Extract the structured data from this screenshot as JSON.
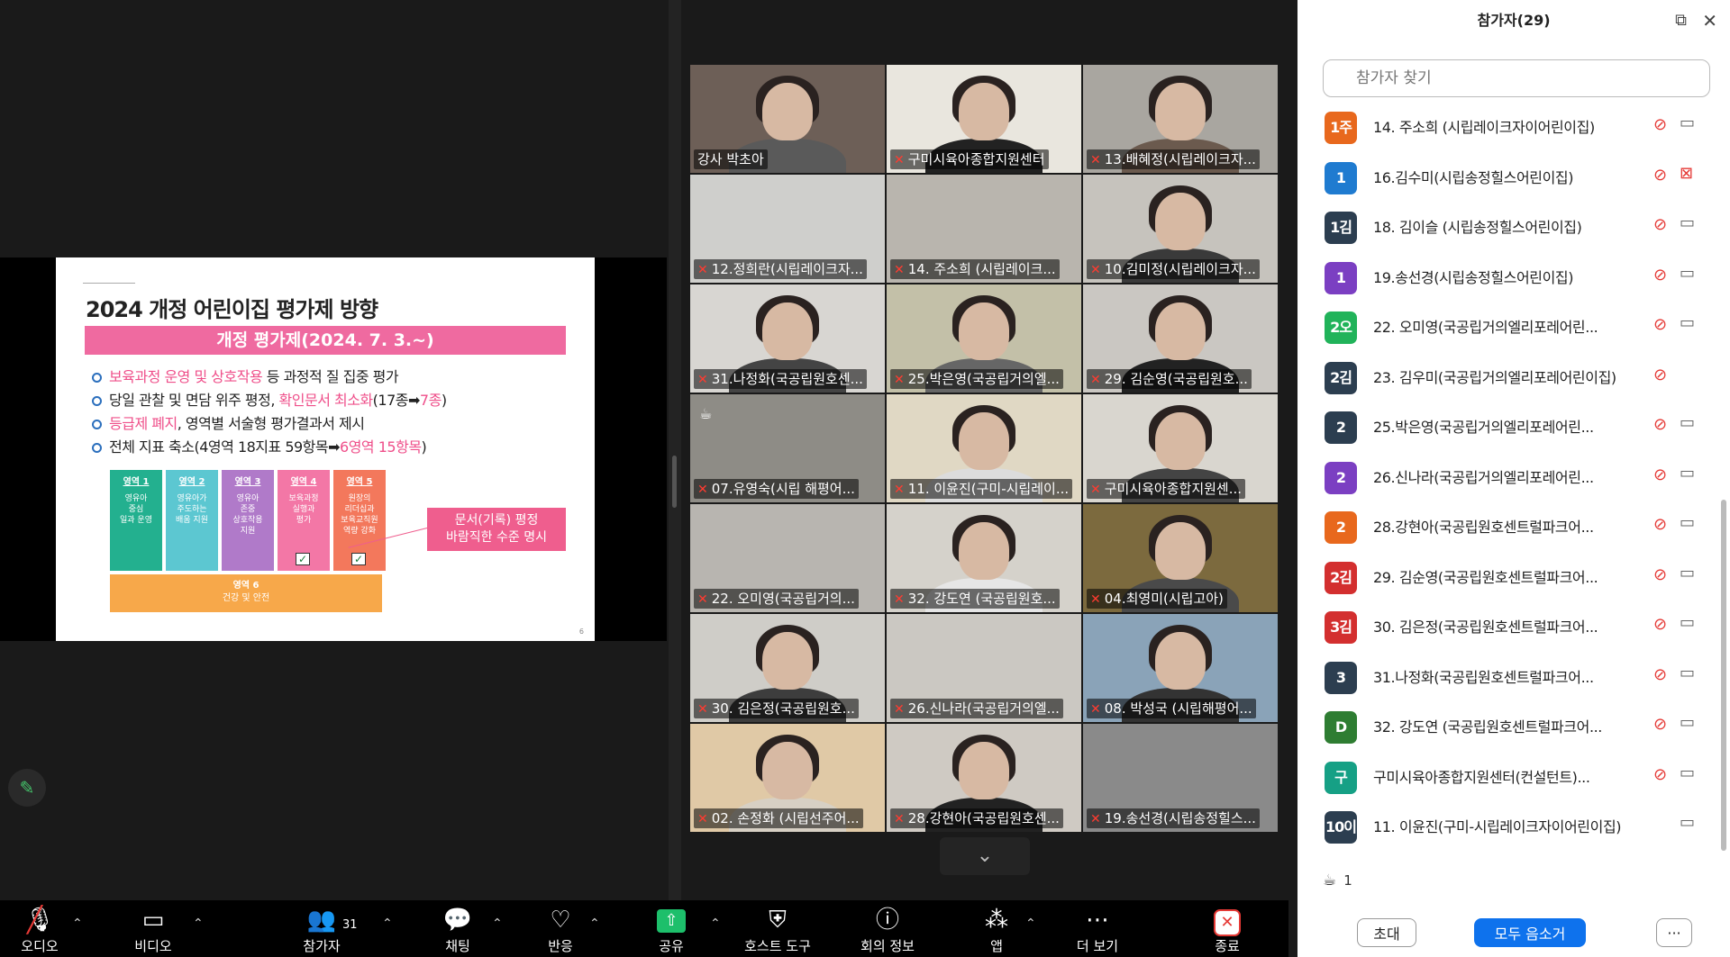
{
  "slide": {
    "title": "2024 개정 어린이집 평가제 방향",
    "band": "개정 평가제(2024. 7. 3.~)",
    "bullets": [
      {
        "hl": "보육과정 운영 및 상호작용",
        "text": " 등 과정적 질 집중 평가"
      },
      {
        "pre": "당일 관찰 및 면담 위주 평정, ",
        "hl": "확인문서 최소화",
        "mid": "(17종➡",
        "hl2": "7종",
        "post": ")"
      },
      {
        "hl": "등급제 폐지",
        "text": ", 영역별 서술형 평가결과서 제시"
      },
      {
        "pre": "전체 지표 축소(4영역 18지표 59항목➡",
        "hl": "6영역 15항목",
        "post": ")"
      }
    ],
    "areas": [
      {
        "head": "영역 1",
        "body": "영유아\n중심\n일과 운영",
        "color": "#23b08f",
        "check": false
      },
      {
        "head": "영역 2",
        "body": "영유아가\n주도하는\n배움 지원",
        "color": "#5cc7d1",
        "check": false
      },
      {
        "head": "영역 3",
        "body": "영유아\n존중\n상호작용\n지원",
        "color": "#b07ac9",
        "check": false
      },
      {
        "head": "영역 4",
        "body": "보육과정\n실행과\n평가",
        "color": "#f377a6",
        "check": true
      },
      {
        "head": "영역 5",
        "body": "원장의\n리더십과\n보육교직원\n역량 강화",
        "color": "#f3785c",
        "check": true
      }
    ],
    "area6": {
      "head": "영역 6",
      "body": "건강 및 안전"
    },
    "callout": "문서(기록) 평정\n바람직한 수준 명시",
    "page_number": "6"
  },
  "gallery": [
    {
      "name": "강사 박초아",
      "muted": false,
      "active": true,
      "bg": "#6d5f57",
      "shirt": "#5a5a5a"
    },
    {
      "name": "구미시육아종합지원센터",
      "muted": true,
      "bg": "#e9e6de",
      "shirt": "#222"
    },
    {
      "name": "13.배혜정(시립레이크자...",
      "muted": true,
      "bg": "#a9a6a0",
      "shirt": "#6b5a4e"
    },
    {
      "name": "12.정희란(시립레이크자...",
      "muted": true,
      "bg": "#cfcfcc",
      "shirt": "#8b8b88",
      "noface": true
    },
    {
      "name": "14. 주소희 (시립레이크...",
      "muted": true,
      "bg": "#b9b5ae",
      "shirt": "#9a948b",
      "noface": true
    },
    {
      "name": "10.김미정(시립레이크자...",
      "muted": true,
      "bg": "#c6c3bd",
      "shirt": "#3a3a3a"
    },
    {
      "name": "31.나정화(국공립원호센...",
      "muted": true,
      "bg": "#d8d6d2",
      "shirt": "#444"
    },
    {
      "name": "25.박은영(국공립거의엘...",
      "muted": true,
      "bg": "#c3c0a8",
      "shirt": "#666"
    },
    {
      "name": "29. 김순영(국공립원호...",
      "muted": true,
      "bg": "#cac7c2",
      "shirt": "#222"
    },
    {
      "name": "07.유영숙(시립 해평어...",
      "muted": true,
      "bg": "#8e8c86",
      "shirt": "#6c6a65",
      "noface": true,
      "cup": true
    },
    {
      "name": "11. 이윤진(구미-시립레이...",
      "muted": true,
      "bg": "#e0d8c4",
      "shirt": "#dcdcdc"
    },
    {
      "name": "구미시육아종합지원센...",
      "muted": true,
      "bg": "#d9d6cf",
      "shirt": "#444"
    },
    {
      "name": "22. 오미영(국공립거의...",
      "muted": true,
      "bg": "#b8b5b0",
      "shirt": "#7d7a76",
      "noface": true
    },
    {
      "name": "32. 강도연 (국공립원호...",
      "muted": true,
      "bg": "#d5d2cb",
      "shirt": "#e6e6e6"
    },
    {
      "name": "04.최영미(시립고아)",
      "muted": true,
      "bg": "#7c6a3e",
      "shirt": "#4a4a4a"
    },
    {
      "name": "30. 김은정(국공립원호...",
      "muted": true,
      "bg": "#cfcdc8",
      "shirt": "#3d3d3d"
    },
    {
      "name": "26.신나라(국공립거의엘...",
      "muted": true,
      "bg": "#cbc8c2",
      "shirt": "#9a9791",
      "noface": true
    },
    {
      "name": "08. 박성국 (시립해평어...",
      "muted": true,
      "bg": "#8aa3b8",
      "shirt": "#333"
    },
    {
      "name": "02. 손정화 (시립선주어...",
      "muted": true,
      "bg": "#e0c9a6",
      "shirt": "#d7d0c4"
    },
    {
      "name": "28.강현아(국공립원호센...",
      "muted": true,
      "bg": "#cfcac3",
      "shirt": "#222"
    },
    {
      "name": "19.송선경(시립송정힐스...",
      "muted": true,
      "bg": "#8a8a8a",
      "shirt": "#555",
      "noface": true
    }
  ],
  "toolbar": {
    "audio": "오디오",
    "video": "비디오",
    "participants": "참가자",
    "participants_count": "31",
    "chat": "채팅",
    "react": "반응",
    "share": "공유",
    "host_tools": "호스트 도구",
    "meeting_info": "회의 정보",
    "apps": "앱",
    "more": "더 보기",
    "end": "종료"
  },
  "panel": {
    "title": "참가자(29)",
    "search_placeholder": "참가자 찾기",
    "participants": [
      {
        "avatar": "1주",
        "color": "#e8681d",
        "name": "14. 주소희 (시립레이크자이어린이집)",
        "mic_muted": true,
        "cam": "on"
      },
      {
        "avatar": "1",
        "color": "#1f7bd0",
        "name": "16.김수미(시립송정힐스어린이집)",
        "mic_muted": true,
        "cam": "off"
      },
      {
        "avatar": "1김",
        "color": "#2c3e50",
        "name": "18. 김이슬 (시립송정힐스어린이집)",
        "mic_muted": true,
        "cam": "on"
      },
      {
        "avatar": "1",
        "color": "#7b3fc2",
        "name": "19.송선경(시립송정힐스어린이집)",
        "mic_muted": true,
        "cam": "on"
      },
      {
        "avatar": "2오",
        "color": "#21b35a",
        "name": "22. 오미영(국공립거의엘리포레어린...",
        "mic_muted": true,
        "cam": "on"
      },
      {
        "avatar": "2김",
        "color": "#2c3e50",
        "name": "23. 김우미(국공립거의엘리포레어린이집)",
        "mic_muted": true,
        "cam": "none"
      },
      {
        "avatar": "2",
        "color": "#2c3e50",
        "name": "25.박은영(국공립거의엘리포레어린...",
        "mic_muted": true,
        "cam": "on"
      },
      {
        "avatar": "2",
        "color": "#7b3fc2",
        "name": "26.신나라(국공립거의엘리포레어린...",
        "mic_muted": true,
        "cam": "on"
      },
      {
        "avatar": "2",
        "color": "#e8681d",
        "name": "28.강현아(국공립원호센트럴파크어...",
        "mic_muted": true,
        "cam": "on"
      },
      {
        "avatar": "2김",
        "color": "#d32f2f",
        "name": "29. 김순영(국공립원호센트럴파크어...",
        "mic_muted": true,
        "cam": "on"
      },
      {
        "avatar": "3김",
        "color": "#d32f2f",
        "name": "30. 김은정(국공립원호센트럴파크어...",
        "mic_muted": true,
        "cam": "on"
      },
      {
        "avatar": "3",
        "color": "#2c3e50",
        "name": "31.나정화(국공립원호센트럴파크어...",
        "mic_muted": true,
        "cam": "on"
      },
      {
        "avatar": "D",
        "color": "#2e7d32",
        "name": "32. 강도연 (국공립원호센트럴파크어...",
        "mic_muted": true,
        "cam": "on"
      },
      {
        "avatar": "구",
        "color": "#16a085",
        "name": "구미시육아종합지원센터(컨설턴트)...",
        "mic_muted": true,
        "cam": "on"
      },
      {
        "avatar": "10이",
        "color": "#2c3e50",
        "name": "11. 이윤진(구미-시립레이크자이어린이집)",
        "mic_muted": false,
        "cam": "on"
      }
    ],
    "raised_count": "1",
    "invite": "초대",
    "mute_all": "모두 음소거",
    "more": "···"
  }
}
